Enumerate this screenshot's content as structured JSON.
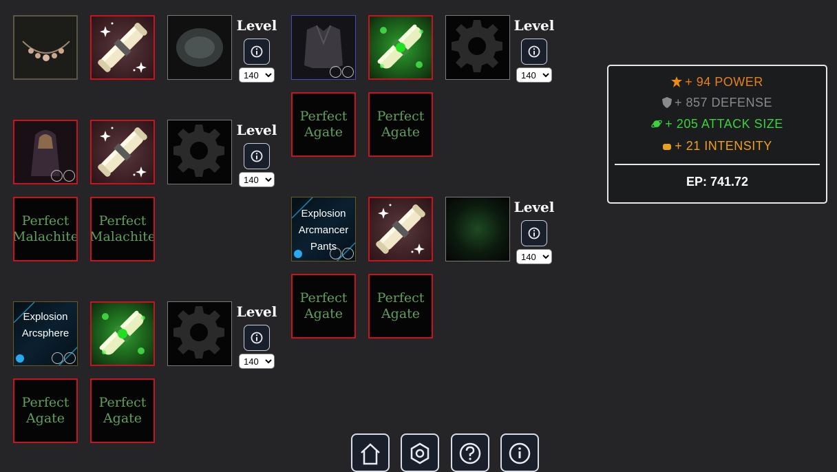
{
  "level_label": "Level",
  "level_value": "140",
  "level_options": [
    "140"
  ],
  "gem_labels": {
    "perfect_agate": "Perfect Agate",
    "perfect_malachite": "Perfect Malachite"
  },
  "items": {
    "pants": "Explosion Arcmancer Pants",
    "sphere": "Explosion Arcsphere"
  },
  "stats": {
    "power": "+ 94 POWER",
    "defense": "+ 857 DEFENSE",
    "attack_size": "+ 205 ATTACK SIZE",
    "intensity": "+ 21 INTENSITY",
    "ep": "EP: 741.72"
  },
  "colors": {
    "background": "#252527",
    "slot_border_red": "#c8141e",
    "gem_text": "#5fa05a",
    "power": "#e8801a",
    "defense": "#8a8a8a",
    "attack_size": "#3ed03e",
    "intensity": "#f0a020"
  },
  "icons": {
    "power": "star-burst-icon",
    "defense": "shield-icon",
    "attack_size": "planet-icon",
    "intensity": "gold-nugget-icon",
    "info": "info-icon",
    "nav": [
      "home-icon",
      "settings-hexagon-icon",
      "help-icon",
      "info-icon"
    ]
  }
}
